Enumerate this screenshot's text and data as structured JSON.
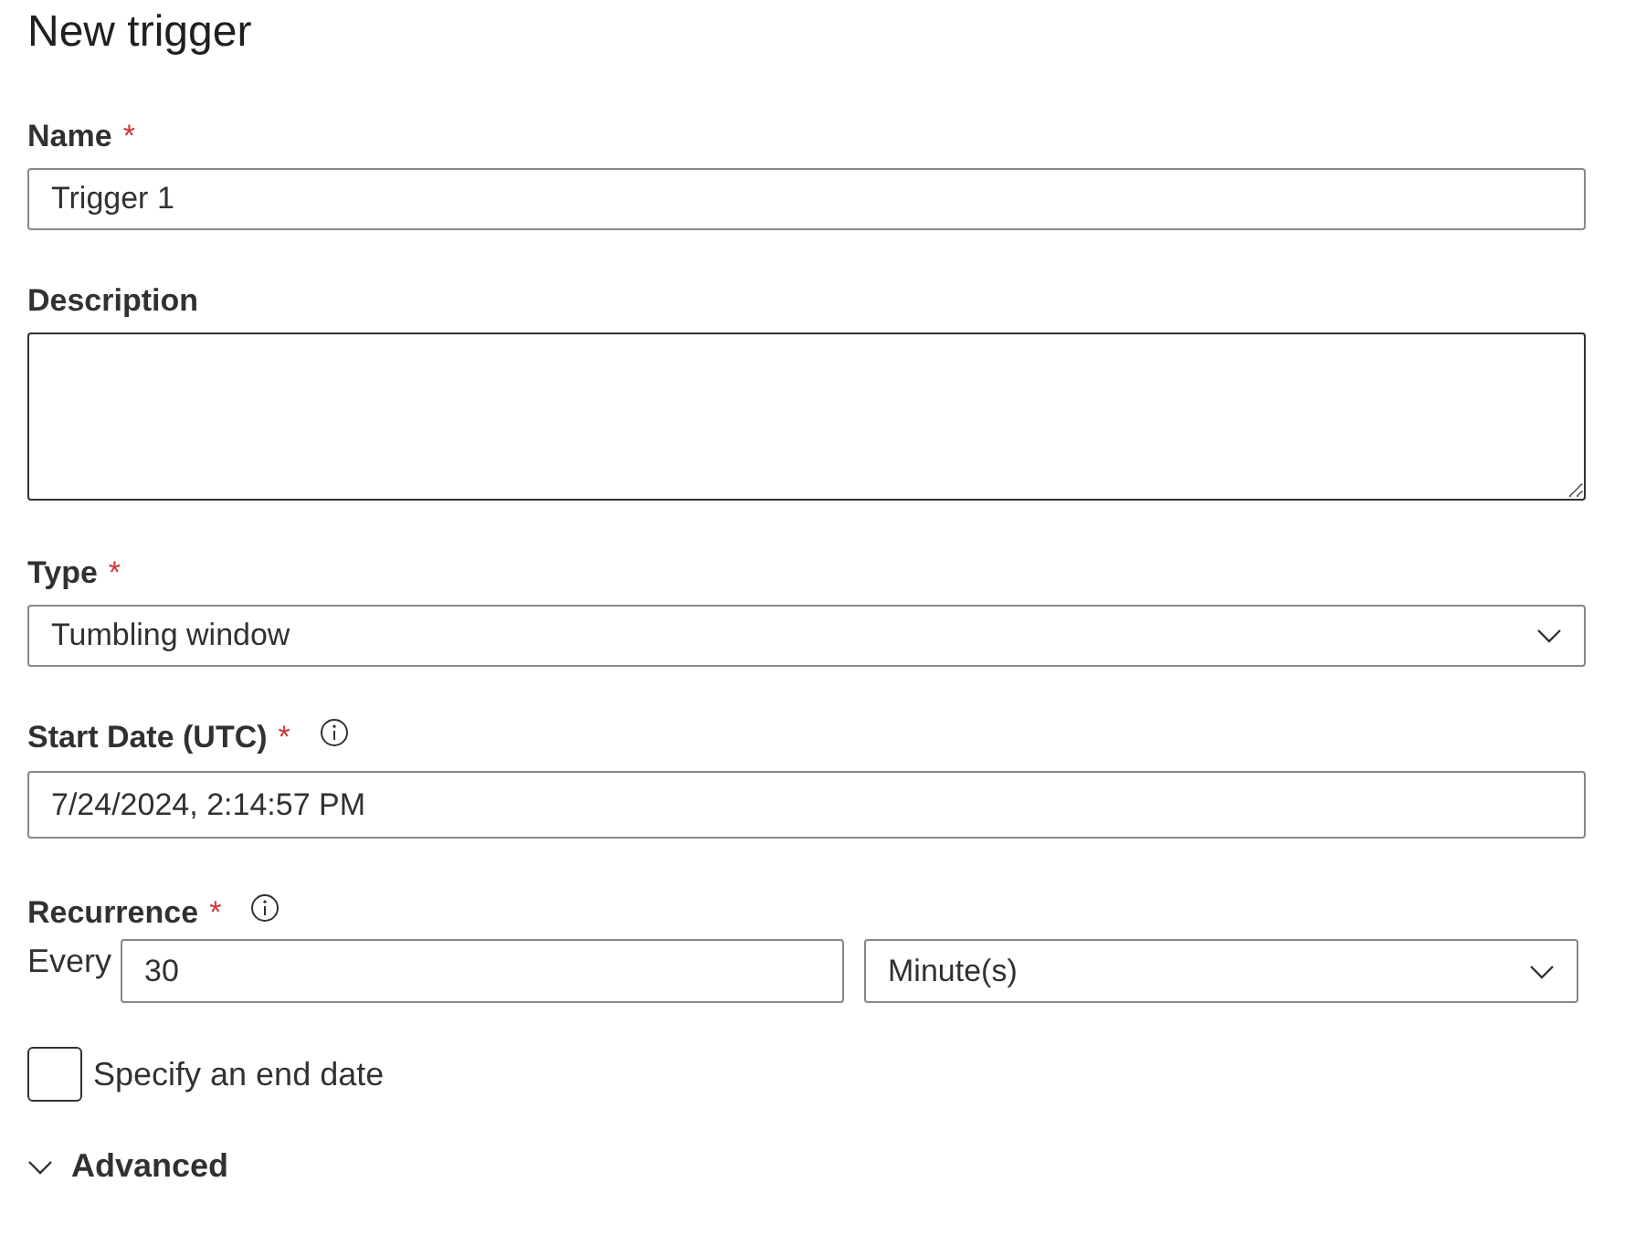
{
  "title": "New trigger",
  "name": {
    "label": "Name",
    "required_mark": "*",
    "value": "Trigger 1"
  },
  "description": {
    "label": "Description"
  },
  "type": {
    "label": "Type",
    "required_mark": "*",
    "value": "Tumbling window"
  },
  "start_date": {
    "label": "Start Date (UTC)",
    "required_mark": "*",
    "info": true,
    "value": "7/24/2024, 2:14:57 PM"
  },
  "recurrence": {
    "label": "Recurrence",
    "required_mark": "*",
    "info": true,
    "every_label": "Every",
    "interval": "30",
    "unit": "Minute(s)"
  },
  "end_date": {
    "label": "Specify an end date",
    "checked": false
  },
  "advanced": {
    "label": "Advanced",
    "expanded": false
  }
}
